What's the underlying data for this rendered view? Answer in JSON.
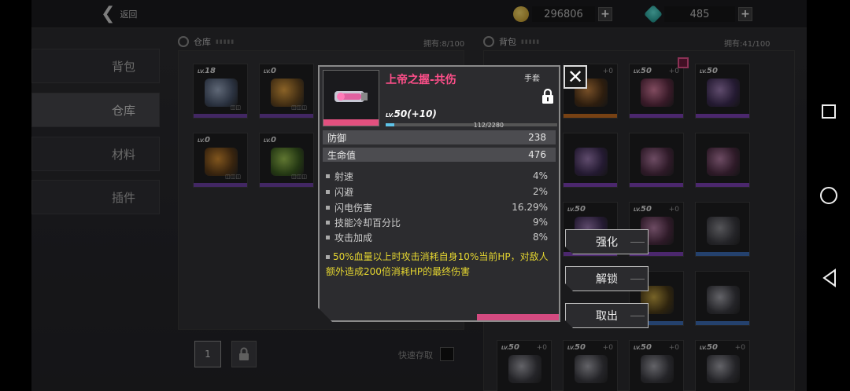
{
  "topbar": {
    "back_label": "返回",
    "gold_amount": "296806",
    "gem_amount": "485",
    "plus": "+",
    "gold_color": "#d4b341",
    "gem_color": "#2bb5ad"
  },
  "tabs": [
    {
      "label": "背包",
      "active": false
    },
    {
      "label": "仓库",
      "active": true
    },
    {
      "label": "材料",
      "active": false
    },
    {
      "label": "插件",
      "active": false
    }
  ],
  "warehouse": {
    "title": "仓库",
    "capacity": "拥有:8/100",
    "items": [
      {
        "lv": "18",
        "plus": ""
      },
      {
        "lv": "0",
        "plus": ""
      },
      {
        "lv": "0",
        "plus": ""
      },
      {
        "lv": "0",
        "plus": ""
      }
    ]
  },
  "bag": {
    "title": "背包",
    "capacity": "拥有:41/100",
    "top_items": [
      {
        "lv": "50",
        "plus": "+0"
      },
      {
        "lv": "50",
        "plus": "+0"
      },
      {
        "lv": "50",
        "plus": "+0"
      }
    ],
    "bottom_items": [
      {
        "lv": "50",
        "plus": "+0"
      },
      {
        "lv": "50",
        "plus": "+0"
      },
      {
        "lv": "50",
        "plus": "+0"
      },
      {
        "lv": "50",
        "plus": "+0"
      },
      {
        "lv": "50",
        "plus": "+0"
      }
    ],
    "mid_items": [
      {
        "lv": "50",
        "plus": "+0"
      },
      {
        "lv": "50",
        "plus": "+0"
      }
    ]
  },
  "bottom": {
    "page": "1",
    "quick_store": "快速存取"
  },
  "popup": {
    "name": "上帝之握-共伤",
    "type": "手套",
    "level": "50",
    "level_bonus": "(+10)",
    "level_prefix": "LV.",
    "exp_text": "112/2280",
    "exp_fraction": 0.049,
    "main_stats": [
      {
        "label": "防御",
        "value": "238"
      },
      {
        "label": "生命值",
        "value": "476"
      }
    ],
    "sub_stats": [
      {
        "label": "射速",
        "value": "4%"
      },
      {
        "label": "闪避",
        "value": "2%"
      },
      {
        "label": "闪电伤害",
        "value": "16.29%"
      },
      {
        "label": "技能冷却百分比",
        "value": "9%"
      },
      {
        "label": "攻击加成",
        "value": "8%"
      }
    ],
    "special": "50%血量以上时攻击消耗自身10%当前HP，对敌人额外造成200倍消耗HP的最终伤害",
    "accent_color": "#e2507f"
  },
  "actions": {
    "enhance": "强化",
    "unlock": "解锁",
    "withdraw": "取出"
  }
}
